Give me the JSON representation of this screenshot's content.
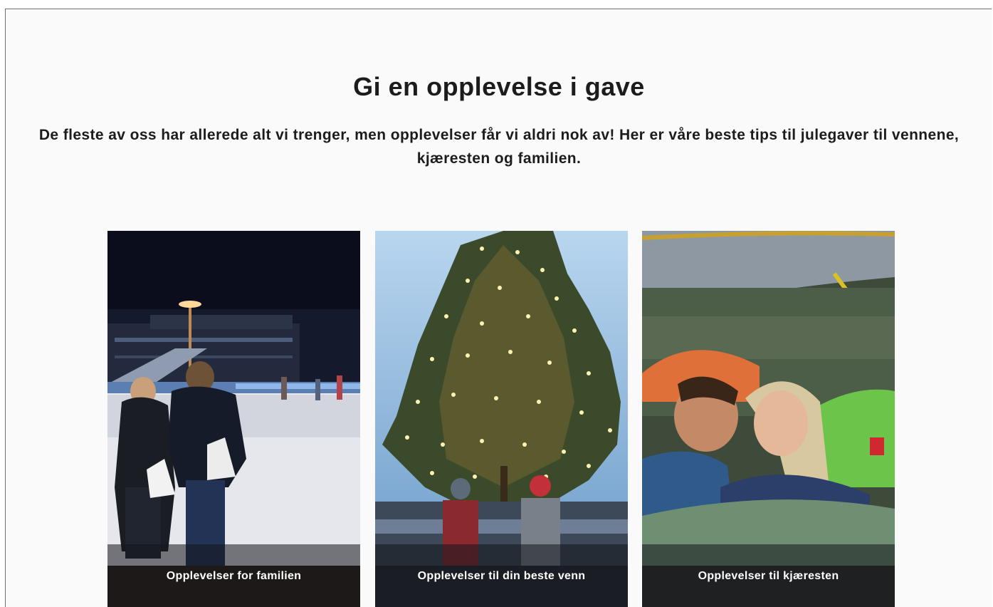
{
  "hero": {
    "title": "Gi en opplevelse i gave",
    "subtitle": "De fleste av oss har allerede alt vi trenger, men opplevelser får vi aldri nok av! Her er våre beste tips til julegaver til vennene, kjæresten og familien."
  },
  "cards": [
    {
      "label": "Opplevelser for familien"
    },
    {
      "label": "Opplevelser til din beste venn"
    },
    {
      "label": "Opplevelser til kjæresten"
    }
  ]
}
